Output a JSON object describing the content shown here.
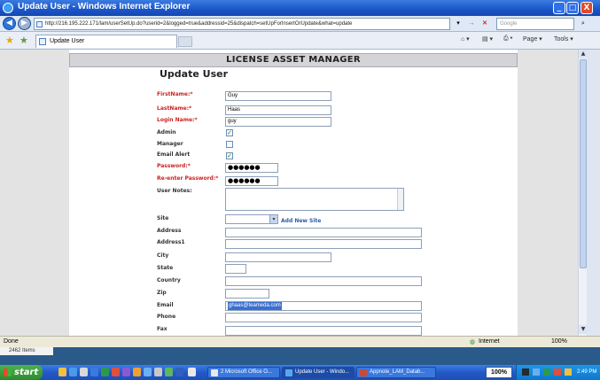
{
  "window": {
    "title": "Update User - Windows Internet Explorer",
    "min_glyph": "_",
    "max_glyph": "□",
    "close_glyph": "X"
  },
  "address": {
    "url": "http://216.195.222.171/lam/userSetUp.do?userid=2&logged=true&addressid=25&dispatch=setUpForInsertOrUpdate&what=update",
    "search_placeholder": "Google",
    "go_glyph": "→",
    "stop_glyph": "✕"
  },
  "tabs": [
    {
      "label": "Update User"
    }
  ],
  "toolbar": {
    "page_label": "Page ▾",
    "tools_label": "Tools ▾"
  },
  "page": {
    "header": "LICENSE ASSET MANAGER",
    "title": "Update User",
    "form": {
      "first_name_label": "FirstName:*",
      "first_name_value": "Guy",
      "last_name_label": "LastName:*",
      "last_name_value": "Haas",
      "login_label": "Login Name:*",
      "login_value": "guy",
      "admin_label": "Admin",
      "admin_checked": "✓",
      "manager_label": "Manager",
      "manager_checked": "",
      "email_alert_label": "Email Alert",
      "email_alert_checked": "✓",
      "password_label": "Password:*",
      "password_value": "●●●●●●",
      "reenter_label": "Re-enter Password:*",
      "reenter_value": "●●●●●●",
      "notes_label": "User Notes:",
      "site_label": "Site",
      "site_value": "",
      "add_site_link": "Add New Site",
      "address_label": "Address",
      "address1_label": "Address1",
      "city_label": "City",
      "state_label": "State",
      "country_label": "Country",
      "zip_label": "Zip",
      "email_label": "Email",
      "email_value": "ghaas@teameda.com",
      "phone_label": "Phone",
      "fax_label": "Fax"
    }
  },
  "status": {
    "left": "Done",
    "zone": "Internet",
    "zoom": "100%",
    "sub": "2462 Items"
  },
  "taskbar": {
    "start_label": "start",
    "tasks": [
      {
        "label": "2 Microsoft Office O..."
      },
      {
        "label": "Update User - Windo..."
      },
      {
        "label": "Appnote_LAM_Datab..."
      }
    ],
    "percent": "100%",
    "clock": "2:49 PM"
  }
}
